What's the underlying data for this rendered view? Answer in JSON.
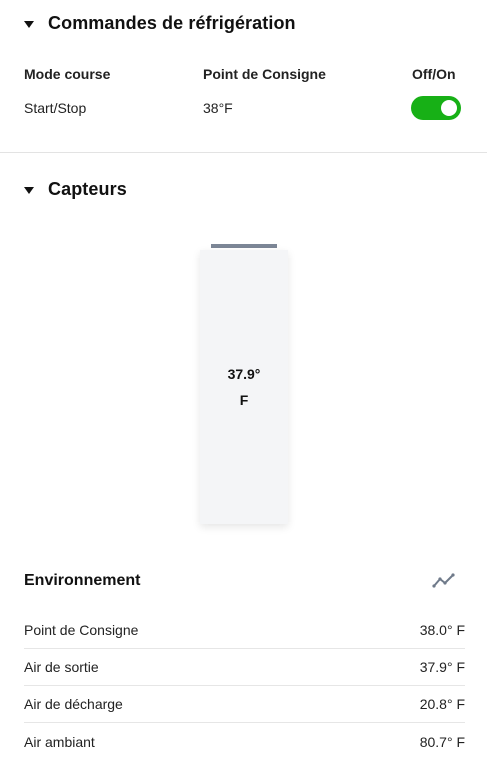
{
  "refrigeration": {
    "title": "Commandes de réfrigération",
    "headers": {
      "mode": "Mode course",
      "setpoint": "Point de Consigne",
      "onoff": "Off/On"
    },
    "mode_value": "Start/Stop",
    "setpoint_value": "38°F",
    "power_on": true,
    "toggle_color": "#17b016"
  },
  "sensors": {
    "title": "Capteurs",
    "gauge": {
      "value": "37.9°",
      "unit": "F"
    }
  },
  "environment": {
    "title": "Environnement",
    "icon": "trend-chart-icon",
    "rows": [
      {
        "label": "Point de Consigne",
        "value": "38.0° F"
      },
      {
        "label": "Air de sortie",
        "value": "37.9° F"
      },
      {
        "label": "Air de décharge",
        "value": "20.8° F"
      },
      {
        "label": "Air ambiant",
        "value": "80.7° F"
      }
    ]
  }
}
